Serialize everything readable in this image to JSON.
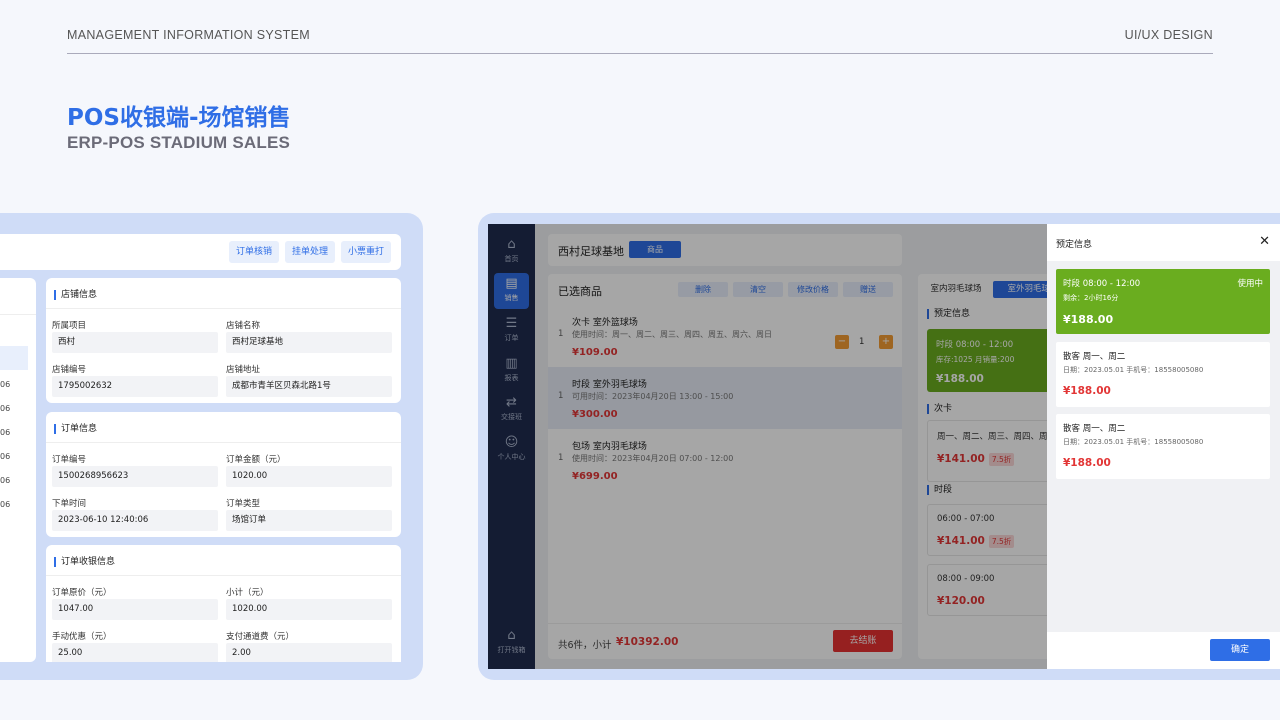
{
  "header": {
    "left": "MANAGEMENT INFORMATION SYSTEM",
    "right": "UI/UX DESIGN"
  },
  "title": {
    "cn": "POS收银端-场馆销售",
    "en": "ERP-POS STADIUM SALES"
  },
  "left_panel": {
    "top_buttons": [
      "订单核销",
      "挂单处理",
      "小票重打"
    ],
    "left_column_rows": [
      "06",
      "06",
      "06",
      "06",
      "06",
      "06"
    ],
    "store_info": {
      "title": "店铺信息",
      "fields": [
        {
          "label": "所属项目",
          "value": "西村"
        },
        {
          "label": "店铺名称",
          "value": "西村足球基地"
        },
        {
          "label": "店铺编号",
          "value": "1795002632"
        },
        {
          "label": "店铺地址",
          "value": "成都市青羊区贝森北路1号"
        }
      ]
    },
    "order_info": {
      "title": "订单信息",
      "fields": [
        {
          "label": "订单编号",
          "value": "1500268956623"
        },
        {
          "label": "订单金额（元）",
          "value": "1020.00"
        },
        {
          "label": "下单时间",
          "value": "2023-06-10 12:40:06"
        },
        {
          "label": "订单类型",
          "value": "场馆订单"
        }
      ]
    },
    "payment_info": {
      "title": "订单收银信息",
      "fields": [
        {
          "label": "订单原价（元）",
          "value": "1047.00"
        },
        {
          "label": "小计（元）",
          "value": "1020.00"
        },
        {
          "label": "手动优惠（元）",
          "value": "25.00"
        },
        {
          "label": "支付通道费（元）",
          "value": "2.00"
        }
      ]
    }
  },
  "pos": {
    "sidebar": [
      {
        "label": "首页",
        "icon": "home-icon",
        "glyph": "⌂"
      },
      {
        "label": "销售",
        "icon": "sales-icon",
        "glyph": "▤"
      },
      {
        "label": "订单",
        "icon": "order-icon",
        "glyph": "☰"
      },
      {
        "label": "报表",
        "icon": "report-icon",
        "glyph": "▥"
      },
      {
        "label": "交接班",
        "icon": "shift-icon",
        "glyph": "⇄"
      },
      {
        "label": "个人中心",
        "icon": "user-icon",
        "glyph": "☺"
      }
    ],
    "sidebar_bottom": {
      "label": "打开钱箱",
      "icon": "cashbox-icon",
      "glyph": "⌂"
    },
    "store_name": "西村足球基地",
    "store_tag": "商品",
    "cart": {
      "title": "已选商品",
      "actions": [
        "删除",
        "清空",
        "修改价格",
        "赠送"
      ],
      "items": [
        {
          "index": "1",
          "name": "次卡 室外篮球场",
          "sub": "使用时间：周一、周二、周三、周四、周五、周六、周日",
          "price": "¥109.00",
          "qty": "1"
        },
        {
          "index": "1",
          "name": "时段 室外羽毛球场",
          "sub": "可用时间：2023年04月20日 13:00 - 15:00",
          "price": "¥300.00"
        },
        {
          "index": "1",
          "name": "包场 室内羽毛球场",
          "sub": "使用时间：2023年04月20日 07:00 - 12:00",
          "price": "¥699.00"
        }
      ],
      "summary": "共6件，小计",
      "total": "¥10392.00",
      "checkout": "去结账"
    },
    "right": {
      "tabs": [
        "室内羽毛球场",
        "室外羽毛球场"
      ],
      "sec_booking": "预定信息",
      "green_card": {
        "time": "时段 08:00 - 12:00",
        "stock": "库存:1025  月销量:200",
        "price": "¥188.00"
      },
      "sec_card": "次卡",
      "card_item": {
        "days": "周一、周二、周三、周四、周五",
        "price": "¥141.00",
        "discount": "7.5折"
      },
      "sec_slot": "时段",
      "slot1": {
        "time": "06:00 - 07:00",
        "price": "¥141.00",
        "discount": "7.5折"
      },
      "slot2": {
        "time": "08:00 - 09:00",
        "price": "¥120.00"
      }
    },
    "drawer": {
      "title": "预定信息",
      "close": "✕",
      "active": {
        "time": "时段 08:00 - 12:00",
        "status": "使用中",
        "remain": "剩余：2小时16分",
        "price": "¥188.00"
      },
      "items": [
        {
          "name": "散客 周一、周二",
          "meta": "日期：2023.05.01  手机号：18558005080",
          "price": "¥188.00"
        },
        {
          "name": "散客 周一、周二",
          "meta": "日期：2023.05.01  手机号：18558005080",
          "price": "¥188.00"
        }
      ],
      "confirm": "确定"
    }
  }
}
